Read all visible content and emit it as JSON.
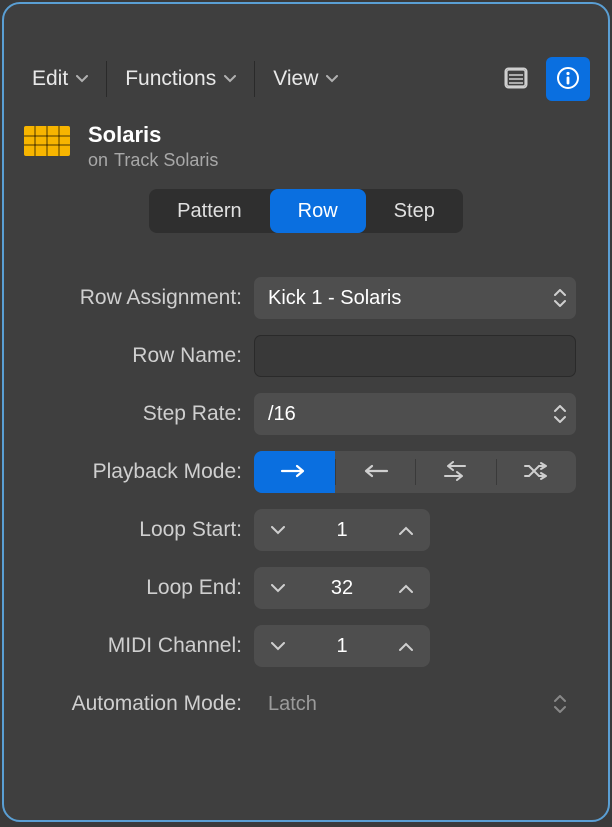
{
  "toolbar": {
    "edit": "Edit",
    "functions": "Functions",
    "view": "View"
  },
  "header": {
    "title": "Solaris",
    "subtitle_prefix": "on",
    "subtitle_track": "Track Solaris"
  },
  "tabs": {
    "pattern": "Pattern",
    "row": "Row",
    "step": "Step"
  },
  "labels": {
    "row_assignment": "Row Assignment:",
    "row_name": "Row Name:",
    "step_rate": "Step Rate:",
    "playback_mode": "Playback Mode:",
    "loop_start": "Loop Start:",
    "loop_end": "Loop End:",
    "midi_channel": "MIDI Channel:",
    "automation_mode": "Automation Mode:"
  },
  "values": {
    "row_assignment": "Kick 1 - Solaris",
    "row_name": "",
    "step_rate": "/16",
    "loop_start": "1",
    "loop_end": "32",
    "midi_channel": "1",
    "automation_mode": "Latch"
  }
}
